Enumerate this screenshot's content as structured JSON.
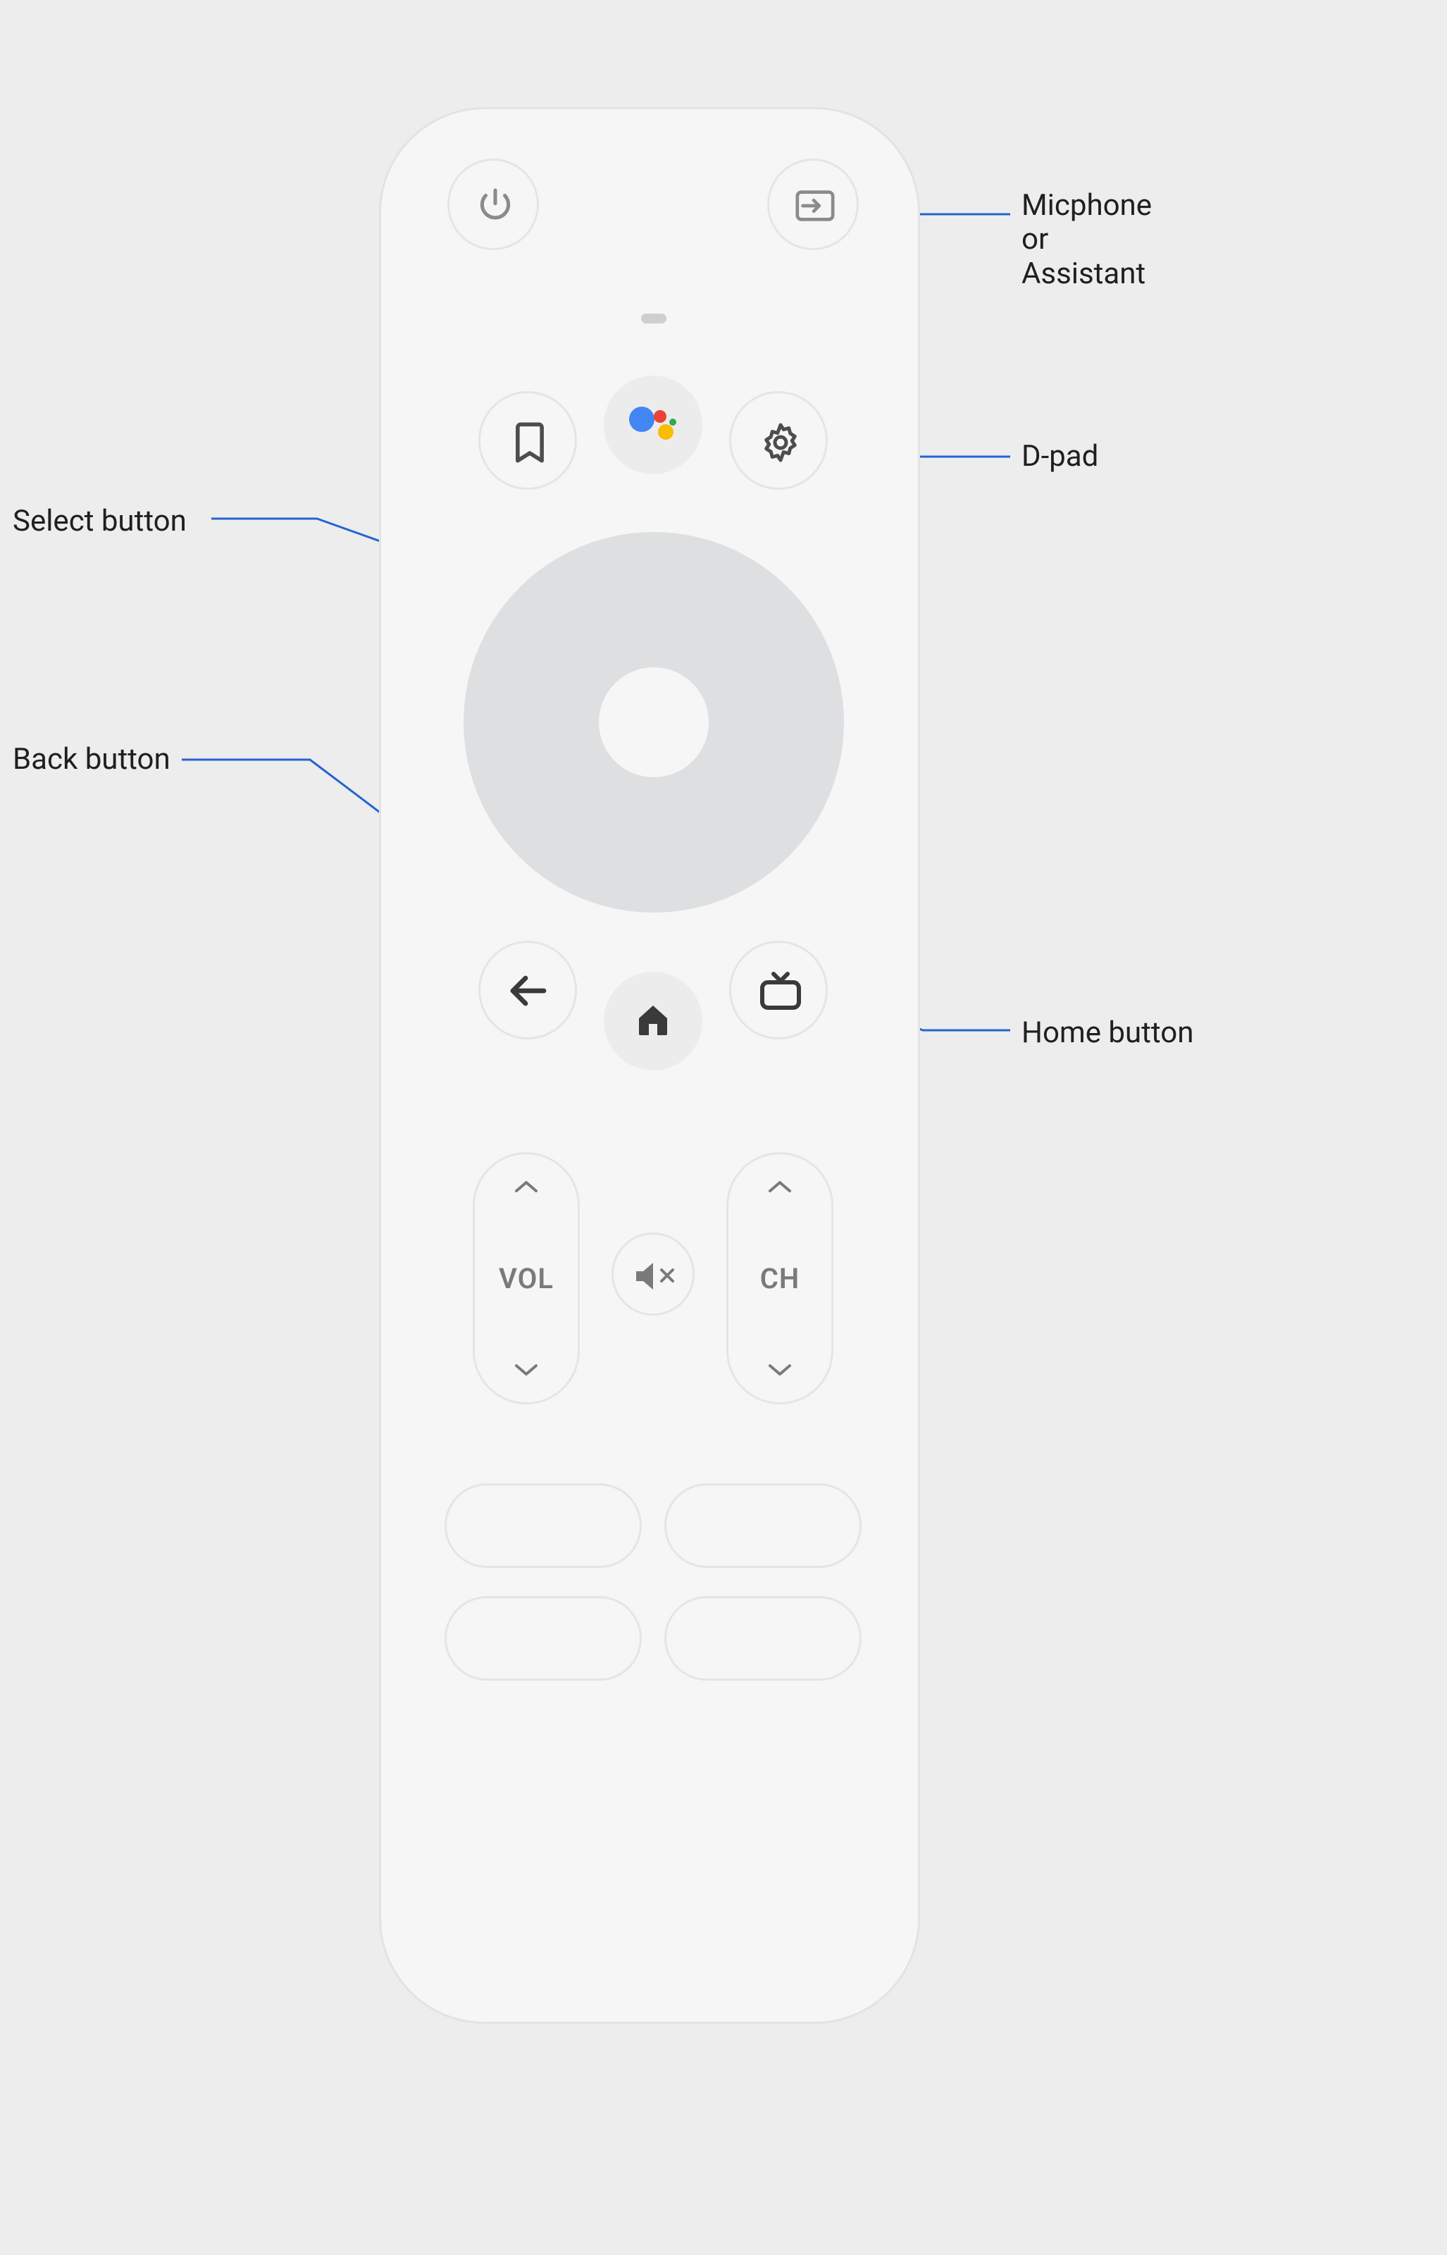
{
  "labels": {
    "assistant": "Micphone\nor\nAssistant",
    "dpad": "D-pad",
    "select": "Select button",
    "back": "Back button",
    "home": "Home button"
  },
  "rocker": {
    "vol": "VOL",
    "ch": "CH"
  },
  "buttons": {
    "power": "power",
    "input": "input",
    "bookmark": "bookmark",
    "assistant": "assistant",
    "settings": "settings",
    "back": "back",
    "home": "home",
    "tv": "tv-guide",
    "mute": "mute",
    "app1": "app-slot-1",
    "app2": "app-slot-2",
    "app3": "app-slot-3",
    "app4": "app-slot-4"
  },
  "colors": {
    "leader": "#2563cf",
    "icon": "#4d4d4d",
    "assistant_blue": "#4285F4",
    "assistant_red": "#EA4335",
    "assistant_yellow": "#FBBC05",
    "assistant_green": "#34A853"
  }
}
